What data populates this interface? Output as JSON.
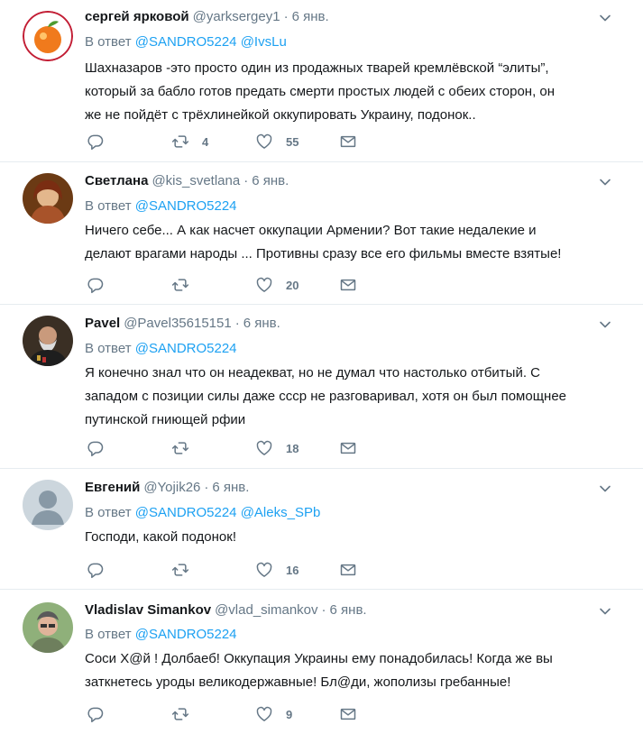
{
  "tweets": [
    {
      "name": "сергей ярковой",
      "handle": "@yarksergey1",
      "time": "6 янв.",
      "reply_prefix": "В ответ",
      "reply_to": [
        "@SANDRO5224",
        "@IvsLu"
      ],
      "lines": [
        "Шахназаров -это просто один из продажных тварей кремлёвской “элиты”,",
        "который за бабло готов предать смерти простых людей с обеих сторон, он",
        "же не пойдёт с трёхлинейкой оккупировать Украину, подонок.."
      ],
      "retweets": "4",
      "likes": "55"
    },
    {
      "name": "Светлана",
      "handle": "@kis_svetlana",
      "time": "6 янв.",
      "reply_prefix": "В ответ",
      "reply_to": [
        "@SANDRO5224"
      ],
      "lines": [
        "Ничего себе... А как насчет оккупации Армении? Вот такие недалекие и",
        "делают врагами народы ... Противны сразу все его фильмы вместе взятые!"
      ],
      "retweets": "",
      "likes": "20"
    },
    {
      "name": "Pavel",
      "handle": "@Pavel35615151",
      "time": "6 янв.",
      "reply_prefix": "В ответ",
      "reply_to": [
        "@SANDRO5224"
      ],
      "lines": [
        "Я конечно знал что он неадекват, но не думал что настолько отбитый. С",
        "западом с позиции силы даже ссср не разговаривал, хотя он был помощнее",
        "путинской гниющей рфии"
      ],
      "retweets": "",
      "likes": "18"
    },
    {
      "name": "Евгений",
      "handle": "@Yojik26",
      "time": "6 янв.",
      "reply_prefix": "В ответ",
      "reply_to": [
        "@SANDRO5224",
        "@Aleks_SPb"
      ],
      "lines": [
        "Господи, какой подонок!"
      ],
      "retweets": "",
      "likes": "16"
    },
    {
      "name": "Vladislav Simankov",
      "handle": "@vlad_simankov",
      "time": "6 янв.",
      "reply_prefix": "В ответ",
      "reply_to": [
        "@SANDRO5224"
      ],
      "lines": [
        "Соси Х@й ! Долбаеб! Оккупация Украины ему понадобилась! Когда же вы",
        "заткнетесь уроды великодержавные! Бл@ди, жополизы гребанные!"
      ],
      "retweets": "",
      "likes": "9"
    }
  ],
  "colors": {
    "link": "#1da1f2",
    "muted": "#657786",
    "text": "#14171a",
    "divider": "#e6ecf0"
  },
  "icons": {
    "reply": "reply-icon",
    "retweet": "retweet-icon",
    "like": "heart-icon",
    "dm": "envelope-icon",
    "more": "chevron-down-icon"
  }
}
